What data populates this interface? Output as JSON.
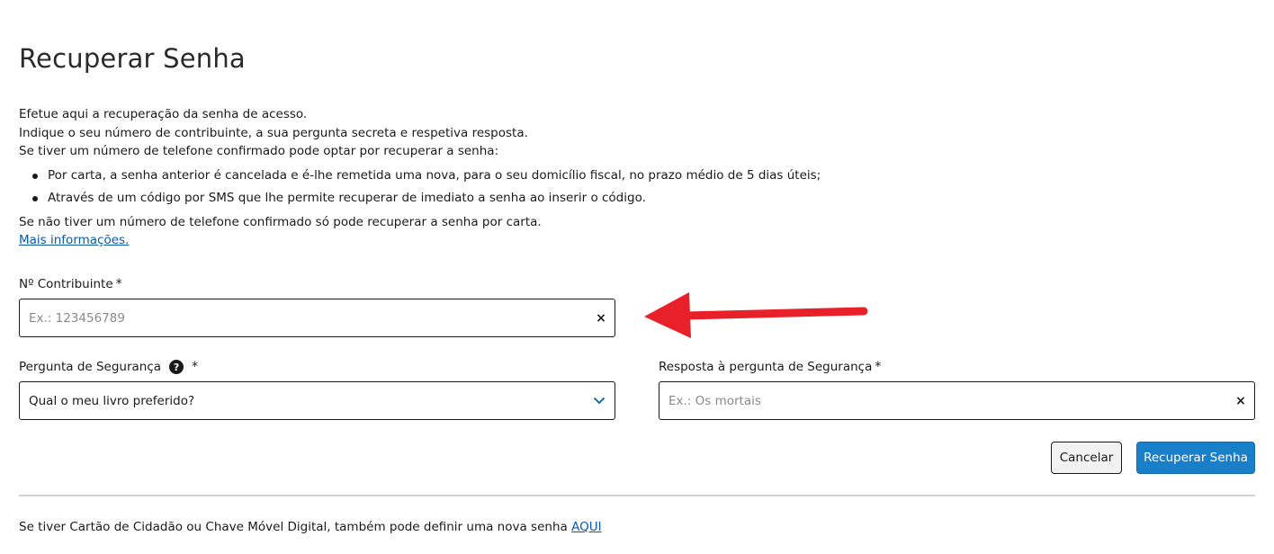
{
  "page": {
    "title": "Recuperar Senha"
  },
  "intro": {
    "line1": "Efetue aqui a recuperação da senha de acesso.",
    "line2": "Indique o seu número de contribuinte, a sua pergunta secreta e respetiva resposta.",
    "line3": "Se tiver um número de telefone confirmado pode optar por recuperar a senha:",
    "bullets": [
      "Por carta, a senha anterior é cancelada e é-lhe remetida uma nova, para o seu domicílio fiscal, no prazo médio de 5 dias úteis;",
      "Através de um código por SMS que lhe permite recuperar de imediato a senha ao inserir o código."
    ],
    "line4": "Se não tiver um número de telefone confirmado só pode recuperar a senha por carta.",
    "more_info_link": "Mais informações."
  },
  "form": {
    "nif": {
      "label": "Nº Contribuinte",
      "required_mark": "*",
      "value": "",
      "placeholder": "Ex.: 123456789",
      "clear_icon": "close-icon"
    },
    "question": {
      "label": "Pergunta de Segurança",
      "help_icon": "?",
      "required_mark": "*",
      "selected": "Qual o meu livro preferido?",
      "chevron_icon": "chevron-down-icon"
    },
    "answer": {
      "label": "Resposta à pergunta de Segurança",
      "required_mark": "*",
      "value": "",
      "placeholder": "Ex.: Os mortais",
      "clear_icon": "close-icon"
    },
    "clear_glyph": "×"
  },
  "buttons": {
    "cancel": "Cancelar",
    "submit": "Recuperar Senha"
  },
  "footer": {
    "text": "Se tiver Cartão de Cidadão ou Chave Móvel Digital, também pode definir uma nova senha",
    "link": "AQUI"
  },
  "colors": {
    "primary": "#1a7fc9",
    "link": "#0a58a8",
    "annotation_arrow": "#e8202a"
  }
}
